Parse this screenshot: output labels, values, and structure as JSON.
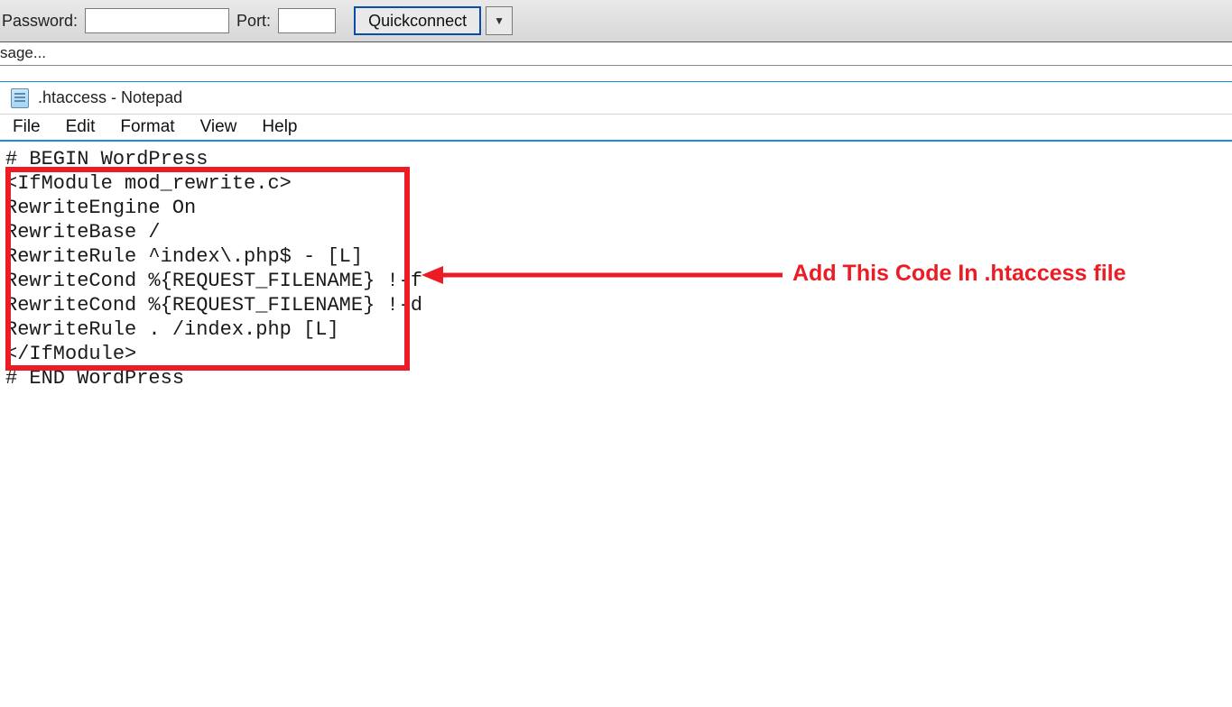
{
  "ftbar": {
    "password_label": "Password:",
    "password_value": "",
    "port_label": "Port:",
    "port_value": "",
    "quickconnect_label": "Quickconnect"
  },
  "msglog": {
    "text": "sage..."
  },
  "notepad": {
    "title": ".htaccess - Notepad",
    "menu": {
      "file": "File",
      "edit": "Edit",
      "format": "Format",
      "view": "View",
      "help": "Help"
    },
    "content": {
      "l0": "# BEGIN WordPress",
      "l1": "<IfModule mod_rewrite.c>",
      "l2": "RewriteEngine On",
      "l3": "RewriteBase /",
      "l4": "RewriteRule ^index\\.php$ - [L]",
      "l5": "RewriteCond %{REQUEST_FILENAME} !-f",
      "l6": "RewriteCond %{REQUEST_FILENAME} !-d",
      "l7": "RewriteRule . /index.php [L]",
      "l8": "</IfModule>",
      "l9": "",
      "l10": "# END WordPress"
    }
  },
  "annotation": {
    "text": "Add This Code In .htaccess file"
  }
}
